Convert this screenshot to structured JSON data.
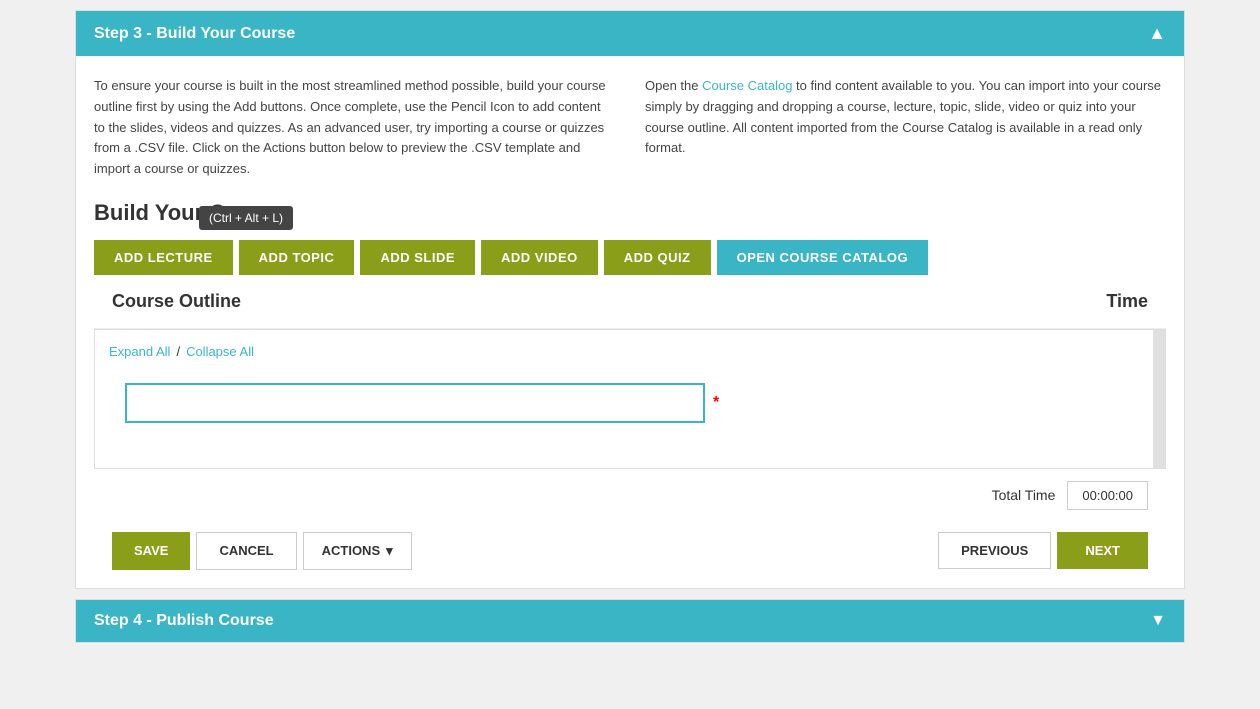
{
  "step3": {
    "header": "Step 3 - Build Your Course",
    "description_left": "To ensure your course is built in the most streamlined method possible, build your course outline first by using the Add buttons. Once complete, use the Pencil Icon to add content to the slides, videos and quizzes. As an advanced user, try importing a course or quizzes from a .CSV file. Click on the Actions button below to preview the .CSV template and import a course or quizzes.",
    "description_right_prefix": "Open the ",
    "description_right_link": "Course Catalog",
    "description_right_suffix": " to find content available to you. You can import into your course simply by dragging and dropping a course, lecture, topic, slide, video or quiz into your course outline. All content imported from the Course Catalog is available in a read only format.",
    "build_title": "Build Your Course",
    "buttons": {
      "add_lecture": "ADD LECTURE",
      "add_topic": "ADD TOPIC",
      "add_slide": "ADD SLIDE",
      "add_video": "ADD VIDEO",
      "add_quiz": "ADD QUIZ",
      "open_catalog": "OPEN COURSE CATALOG"
    },
    "tooltip": "(Ctrl + Alt + L)",
    "outline": {
      "title": "Course Outline",
      "time_label": "Time",
      "expand_all": "Expand All",
      "divider": "/",
      "collapse_all": "Collapse All",
      "input_placeholder": "",
      "required_marker": "*",
      "total_time_label": "Total Time",
      "total_time_value": "00:00:00"
    },
    "actions": {
      "save": "SAVE",
      "cancel": "CANCEL",
      "actions": "ACTIONS",
      "actions_chevron": "▾",
      "previous": "PREVIOUS",
      "next": "NEXT"
    }
  },
  "step4": {
    "header": "Step 4 - Publish Course"
  }
}
